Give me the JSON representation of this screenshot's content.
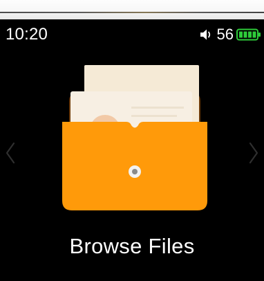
{
  "status_bar": {
    "time": "10:20",
    "volume_icon": "speaker-icon",
    "volume_level": "56",
    "battery_icon": "battery-icon",
    "battery_color": "#2ecc3a"
  },
  "main": {
    "art_icon": "folder-documents-icon",
    "title": "Browse Files",
    "folder_color": "#ff9a0a",
    "prev_icon": "chevron-left-icon",
    "next_icon": "chevron-right-icon"
  }
}
